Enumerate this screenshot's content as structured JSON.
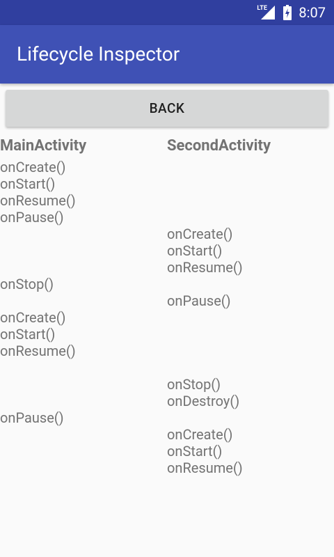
{
  "status_bar": {
    "network_label": "LTE",
    "icons": [
      "signal-icon",
      "battery-charging-icon"
    ],
    "time": "8:07"
  },
  "app_bar": {
    "title": "Lifecycle Inspector"
  },
  "back_button": {
    "label": "BACK"
  },
  "columns": {
    "main": {
      "header": "MainActivity",
      "lines": [
        "onCreate()",
        "onStart()",
        "onResume()",
        "onPause()",
        "",
        "",
        "",
        "onStop()",
        "",
        "onCreate()",
        "onStart()",
        "onResume()",
        "",
        "",
        "",
        "onPause()",
        "",
        "",
        ""
      ]
    },
    "second": {
      "header": "SecondActivity",
      "lines": [
        "",
        "",
        "",
        "",
        "onCreate()",
        "onStart()",
        "onResume()",
        "",
        "onPause()",
        "",
        "",
        "",
        "",
        "onStop()",
        "onDestroy()",
        "",
        "onCreate()",
        "onStart()",
        "onResume()"
      ]
    }
  },
  "colors": {
    "status_bar": "#303f9f",
    "app_bar": "#3f51b5",
    "background": "#fafafa",
    "button": "#d6d7d7",
    "text_gray": "#737373"
  }
}
